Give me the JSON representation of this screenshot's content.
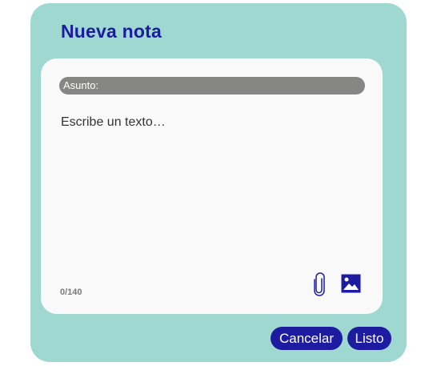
{
  "dialog": {
    "title": "Nueva nota",
    "subject_label": "Asunto:",
    "body_placeholder": "Escribe un texto…",
    "char_counter": "0/140",
    "icons": {
      "attach": "paperclip-icon",
      "image": "image-icon"
    }
  },
  "actions": {
    "cancel_label": "Cancelar",
    "done_label": "Listo"
  },
  "colors": {
    "dialog_bg": "#9ed8d1",
    "accent": "#1d1ca0",
    "card_bg": "#f9f9f9",
    "subject_bar": "#868784"
  }
}
